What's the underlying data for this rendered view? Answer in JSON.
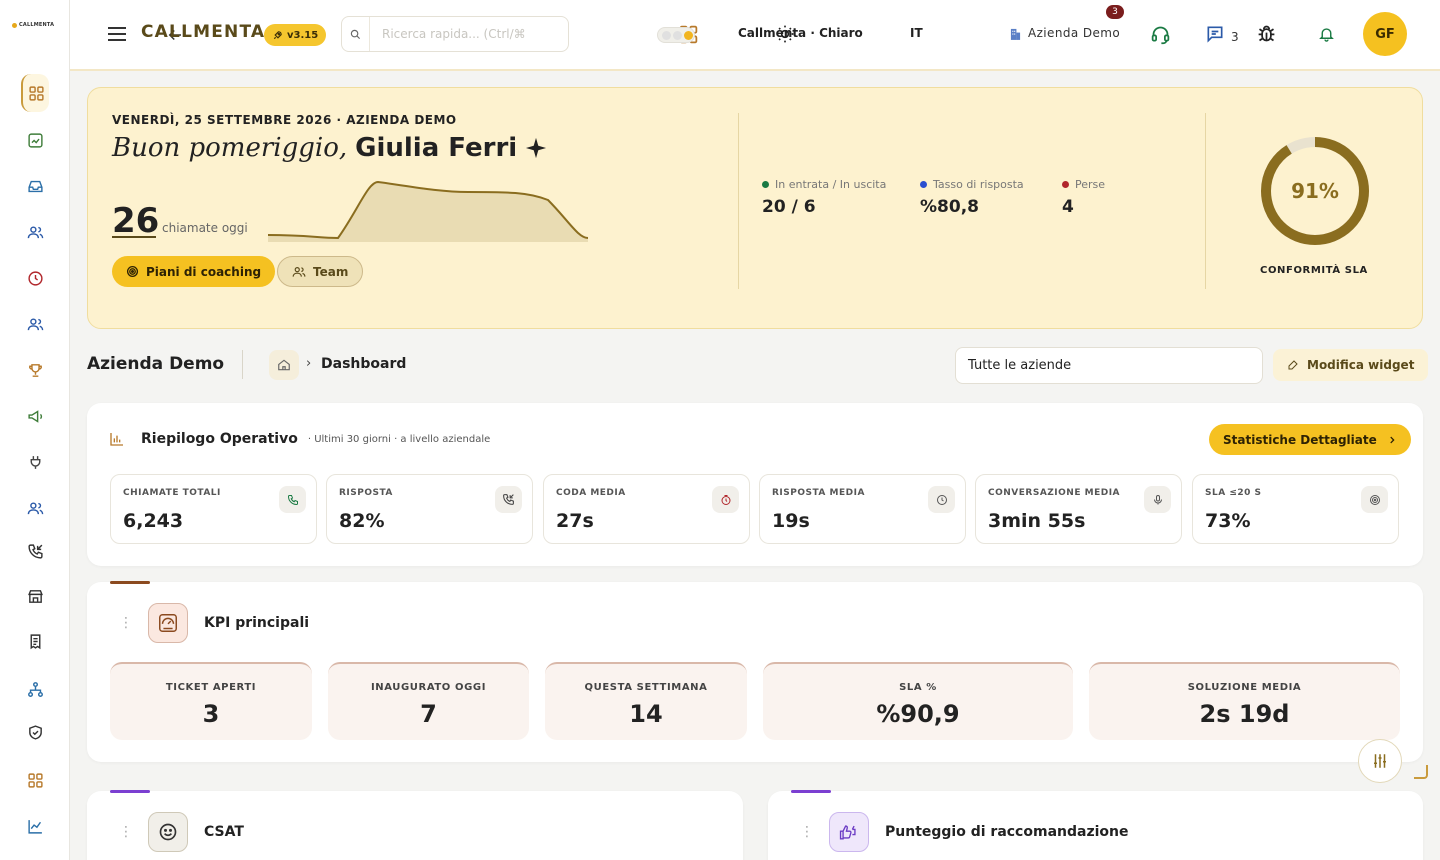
{
  "app": {
    "logo_text": "CALLMENTA",
    "brand": "CALLMENTA",
    "version": "v3.15"
  },
  "topbar": {
    "search_placeholder": "Ricerca rapida... (Ctrl/⌘",
    "theme_label": "Callmenta · Chiaro",
    "language": "IT",
    "company": "Azienda Demo",
    "support_badge": "3",
    "notification_count": "3",
    "avatar_initials": "GF"
  },
  "hero": {
    "date_line": "VENERDÌ, 25 SETTEMBRE 2026 · AZIENDA DEMO",
    "greeting": "Buon pomeriggio,",
    "user_name": "Giulia Ferri",
    "calls_today": "26",
    "calls_today_label": "chiamate oggi",
    "coaching_button": "Piani di coaching",
    "team_button": "Team",
    "stats": [
      {
        "label": "In entrata / In uscita",
        "value": "20 / 6",
        "color": "#1a7a43"
      },
      {
        "label": "Tasso di risposta",
        "value": "%80,8",
        "color": "#2b4fd0"
      },
      {
        "label": "Perse",
        "value": "4",
        "color": "#b1262b"
      }
    ],
    "sla_value": "91%",
    "sla_fraction": 0.91,
    "sla_label": "CONFORMITÀ SLA"
  },
  "breadcrumb": {
    "company_title": "Azienda Demo",
    "current": "Dashboard",
    "company_select": "Tutte le aziende",
    "edit_widget": "Modifica widget"
  },
  "summary": {
    "title": "Riepilogo Operativo",
    "subtitle": "· Ultimi 30 giorni · a livello aziendale",
    "stats_button": "Statistiche Dettagliate",
    "metrics": [
      {
        "label": "CHIAMATE TOTALI",
        "value": "6,243",
        "icon": "phone-icon"
      },
      {
        "label": "RISPOSTA",
        "value": "82%",
        "icon": "phone-incoming-icon"
      },
      {
        "label": "CODA MEDIA",
        "value": "27s",
        "icon": "timer-icon"
      },
      {
        "label": "RISPOSTA MEDIA",
        "value": "19s",
        "icon": "clock-icon"
      },
      {
        "label": "CONVERSAZIONE MEDIA",
        "value": "3min 55s",
        "icon": "microphone-icon"
      },
      {
        "label": "SLA ≤20 S",
        "value": "73%",
        "icon": "target-icon"
      }
    ]
  },
  "kpi": {
    "title": "KPI principali",
    "tiles": [
      {
        "label": "TICKET APERTI",
        "value": "3"
      },
      {
        "label": "INAUGURATO OGGI",
        "value": "7"
      },
      {
        "label": "QUESTA SETTIMANA",
        "value": "14"
      },
      {
        "label": "SLA %",
        "value": "%90,9"
      },
      {
        "label": "SOLUZIONE MEDIA",
        "value": "2s 19d"
      }
    ]
  },
  "widgets": {
    "csat_title": "CSAT",
    "nps_title": "Punteggio di raccomandazione"
  },
  "colors": {
    "accent": "#f5c121",
    "hero_bg": "#fdf2cf",
    "ring": "#8a6d1f",
    "kpi_accent": "#8b4a1f",
    "widget_accent": "#7b3fd1"
  }
}
